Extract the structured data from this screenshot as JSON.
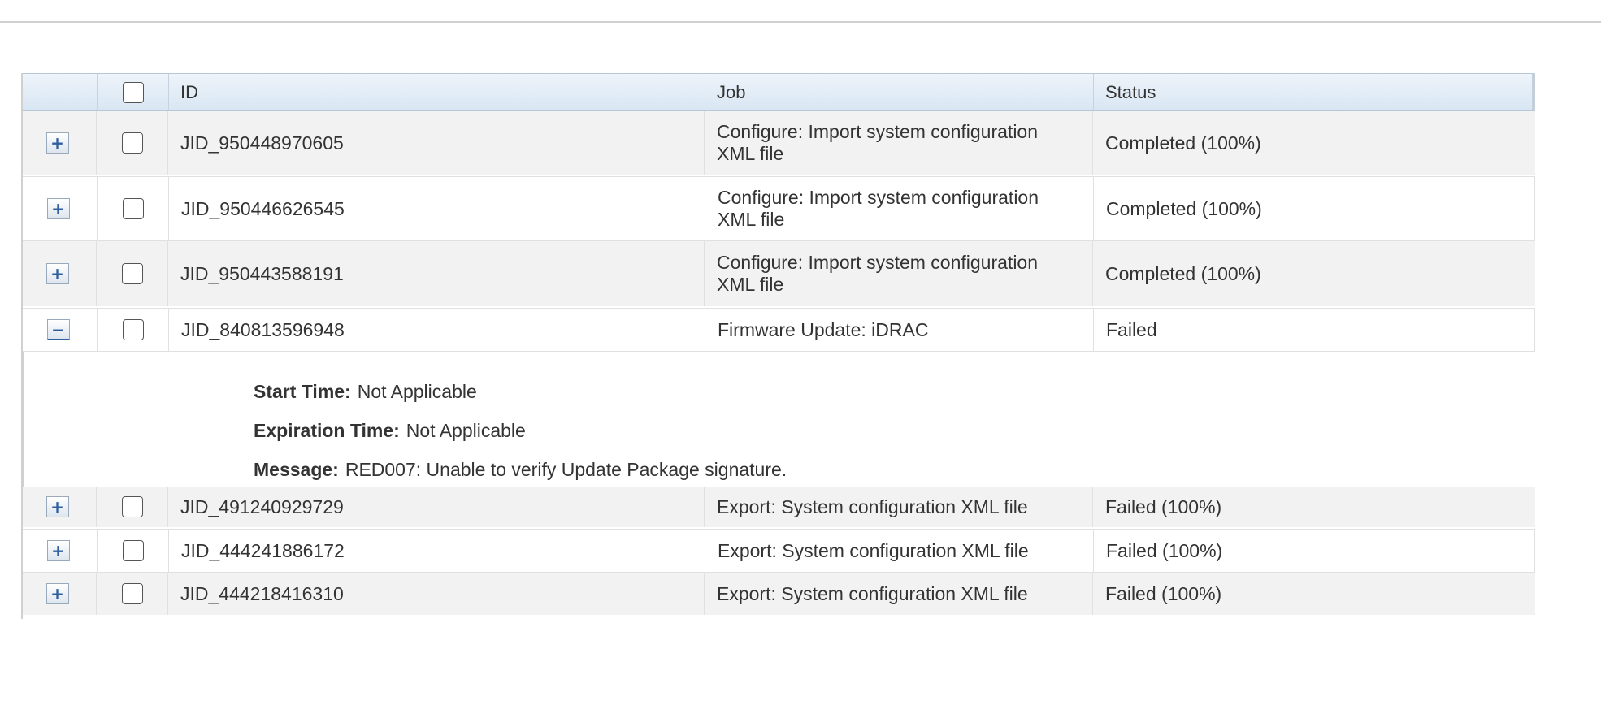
{
  "table": {
    "headers": {
      "id": "ID",
      "job": "Job",
      "status": "Status"
    },
    "rows": [
      {
        "id": "JID_950448970605",
        "job": "Configure: Import system configuration XML file",
        "status": "Completed (100%)",
        "expand": "+"
      },
      {
        "id": "JID_950446626545",
        "job": "Configure: Import system configuration XML file",
        "status": "Completed (100%)",
        "expand": "+"
      },
      {
        "id": "JID_950443588191",
        "job": "Configure: Import system configuration XML file",
        "status": "Completed (100%)",
        "expand": "+"
      },
      {
        "id": "JID_840813596948",
        "job": "Firmware Update: iDRAC",
        "status": "Failed",
        "expand": "−"
      },
      {
        "id": "JID_491240929729",
        "job": "Export: System configuration XML file",
        "status": "Failed (100%)",
        "expand": "+"
      },
      {
        "id": "JID_444241886172",
        "job": "Export: System configuration XML file",
        "status": "Failed (100%)",
        "expand": "+"
      },
      {
        "id": "JID_444218416310",
        "job": "Export: System configuration XML file",
        "status": "Failed (100%)",
        "expand": "+"
      }
    ],
    "detail": {
      "start_label": "Start Time:",
      "start_value": "Not Applicable",
      "expiration_label": "Expiration Time:",
      "expiration_value": "Not Applicable",
      "message_label": "Message:",
      "message_value": "RED007: Unable to verify Update Package signature."
    }
  },
  "icons": {
    "expand": "plus-icon",
    "collapse": "minus-icon"
  },
  "colors": {
    "header_gradient_top": "#eef4fa",
    "header_gradient_bottom": "#d8e6f3",
    "row_alt": "#f2f2f2",
    "expand_icon": "#2f5f9e"
  }
}
